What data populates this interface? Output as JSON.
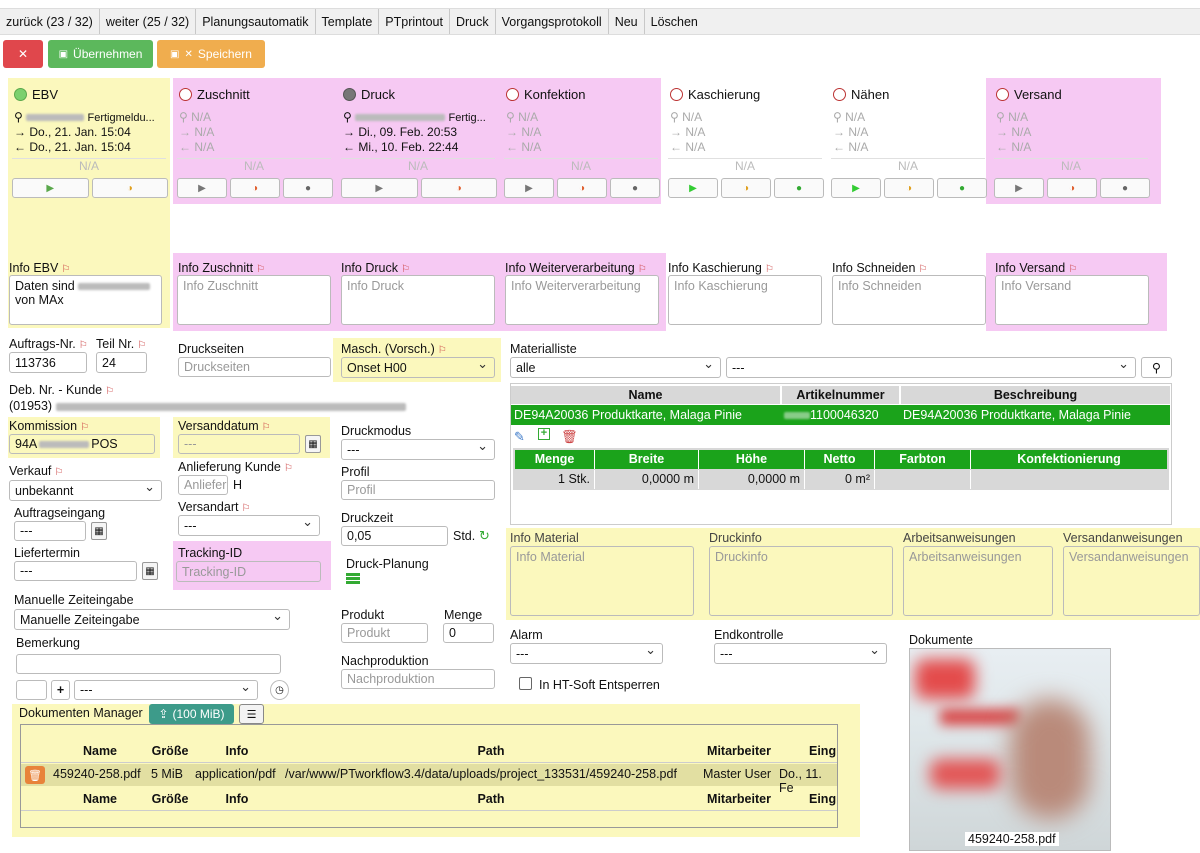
{
  "menu": [
    "zurück (23 / 32)",
    "weiter (25 / 32)",
    "Planungsautomatik",
    "Template",
    "PTprintout",
    "Druck",
    "Vorgangsprotokoll",
    "Neu",
    "Löschen"
  ],
  "toolbar": {
    "close": "✕",
    "apply": "Übernehmen",
    "save": "Speichern"
  },
  "stages": [
    {
      "name": "EBV",
      "status": "green",
      "user": "Fertigmeldu...",
      "in": "Do., 21. Jan. 15:04",
      "out": "Do., 21. Jan. 15:04",
      "na": "N/A"
    },
    {
      "name": "Zuschnitt",
      "status": "open",
      "user": "N/A",
      "in": "N/A",
      "out": "N/A",
      "na": "N/A"
    },
    {
      "name": "Druck",
      "status": "dark",
      "user": "Fertig...",
      "in": "Di., 09. Feb. 20:53",
      "out": "Mi., 10. Feb. 22:44",
      "na": "N/A"
    },
    {
      "name": "Konfektion",
      "status": "open",
      "user": "N/A",
      "in": "N/A",
      "out": "N/A",
      "na": "N/A"
    },
    {
      "name": "Kaschierung",
      "status": "open",
      "user": "N/A",
      "in": "N/A",
      "out": "N/A",
      "na": "N/A"
    },
    {
      "name": "Nähen",
      "status": "open",
      "user": "N/A",
      "in": "N/A",
      "out": "N/A",
      "na": "N/A"
    },
    {
      "name": "Versand",
      "status": "open",
      "user": "N/A",
      "in": "N/A",
      "out": "N/A",
      "na": "N/A"
    }
  ],
  "info": {
    "ebv_label": "Info EBV",
    "ebv_value": "Daten sind",
    "ebv_value2": "von MAx",
    "zuschnitt_label": "Info Zuschnitt",
    "zuschnitt_ph": "Info Zuschnitt",
    "druck_label": "Info Druck",
    "druck_ph": "Info Druck",
    "weiter_label": "Info Weiterverarbeitung",
    "weiter_ph": "Info Weiterverarbeitung",
    "kasch_label": "Info Kaschierung",
    "kasch_ph": "Info Kaschierung",
    "schneiden_label": "Info Schneiden",
    "schneiden_ph": "Info Schneiden",
    "versand_label": "Info Versand",
    "versand_ph": "Info Versand"
  },
  "order": {
    "auftrag_label": "Auftrags-Nr.",
    "auftrag": "113736",
    "teil_label": "Teil Nr.",
    "teil": "24",
    "deb_label": "Deb. Nr. - Kunde",
    "deb": "(01953)",
    "kommission_label": "Kommission",
    "kommission_a": "94A",
    "kommission_b": "POS",
    "verkauf_label": "Verkauf",
    "verkauf": "unbekannt",
    "auftragseingang_label": "Auftragseingang",
    "auftragseingang": "---",
    "liefertermin_label": "Liefertermin",
    "liefertermin": "---",
    "zeit_label": "Manuelle Zeiteingabe",
    "zeit": "Manuelle Zeiteingabe",
    "bemerkung_label": "Bemerkung",
    "bem_select": "---"
  },
  "mid": {
    "druckseiten_label": "Druckseiten",
    "druckseiten_ph": "Druckseiten",
    "versanddatum_label": "Versanddatum",
    "versanddatum": "---",
    "anlieferung_label": "Anlieferung Kunde",
    "anlieferung_ph": "Anliefer",
    "anlieferung_unit": "H",
    "versandart_label": "Versandart",
    "versandart": "---",
    "tracking_label": "Tracking-ID",
    "tracking_ph": "Tracking-ID",
    "masch_label": "Masch. (Vorsch.)",
    "masch": "Onset H00",
    "druckmodus_label": "Druckmodus",
    "druckmodus": "---",
    "profil_label": "Profil",
    "profil_ph": "Profil",
    "druckzeit_label": "Druckzeit",
    "druckzeit": "0,05",
    "druckzeit_unit": "Std.",
    "planung_label": "Druck-Planung",
    "produkt_label": "Produkt",
    "produkt_ph": "Produkt",
    "menge_label": "Menge",
    "menge": "0",
    "nachprod_label": "Nachproduktion",
    "nachprod_ph": "Nachproduktion"
  },
  "material": {
    "label": "Materialliste",
    "filter": "alle",
    "select": "---",
    "headers": [
      "Name",
      "Artikelnummer",
      "Beschreibung"
    ],
    "row": {
      "name": "DE94A20036 Produktkarte, Malaga Pinie",
      "artnr": "1100046320",
      "desc": "DE94A20036 Produktkarte, Malaga Pinie"
    },
    "sub_headers": [
      "Menge",
      "Breite",
      "Höhe",
      "Netto",
      "Farbton",
      "Konfektionierung"
    ],
    "sub_row": [
      "1 Stk.",
      "0,0000 m",
      "0,0000 m",
      "0 m²",
      "",
      ""
    ]
  },
  "notes": {
    "material_label": "Info Material",
    "material_ph": "Info Material",
    "druckinfo_label": "Druckinfo",
    "druckinfo_ph": "Druckinfo",
    "arbeit_label": "Arbeitsanweisungen",
    "arbeit_ph": "Arbeitsanweisungen",
    "versandanw_label": "Versandanweisungen",
    "versandanw_ph": "Versandanweisungen"
  },
  "alarm": {
    "label": "Alarm",
    "value": "---",
    "end_label": "Endkontrolle",
    "end_value": "---",
    "ht_label": "In HT-Soft Entsperren"
  },
  "docs": {
    "manager_label": "Dokumenten Manager",
    "upload_label": "(100 MiB)",
    "headers": [
      "Name",
      "Größe",
      "Info",
      "Path",
      "Mitarbeiter",
      "Eing"
    ],
    "row": [
      "459240-258.pdf",
      "5 MiB",
      "application/pdf",
      "/var/www/PTworkflow3.4/data/uploads/project_133531/459240-258.pdf",
      "Master User",
      "Do., 11. Fe"
    ],
    "dokumente_label": "Dokumente",
    "thumb_caption": "459240-258.pdf"
  },
  "colors": {
    "yellow": "#fbf8bd",
    "pink": "#f6c9f3",
    "green": "#1ba31b",
    "red": "#e0474c",
    "apply": "#5cb85c",
    "save": "#f0ad4e"
  }
}
